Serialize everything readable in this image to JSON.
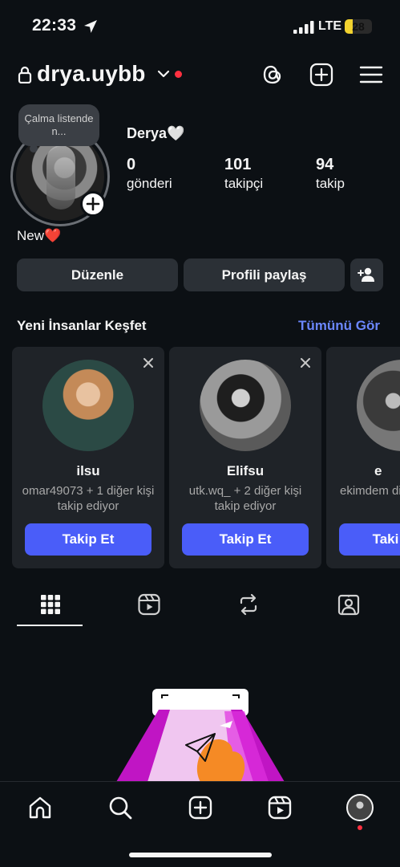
{
  "status_bar": {
    "time": "22:33",
    "network": "LTE",
    "battery": "28",
    "battery_level": 0.28
  },
  "header": {
    "username": "drya.uybb",
    "icons": [
      "lock-icon",
      "chevron-down-icon",
      "threads-icon",
      "create-icon",
      "menu-icon"
    ]
  },
  "profile": {
    "note": "Çalma listende n...",
    "display_name": "Derya🤍",
    "bio": "New❤️",
    "stats": [
      {
        "value": "0",
        "label": "gönderi"
      },
      {
        "value": "101",
        "label": "takipçi"
      },
      {
        "value": "94",
        "label": "takip"
      }
    ]
  },
  "actions": {
    "edit": "Düzenle",
    "share": "Profili paylaş"
  },
  "discover": {
    "title": "Yeni İnsanlar Keşfet",
    "see_all": "Tümünü Gör",
    "cards": [
      {
        "name": "ilsu",
        "subtitle": "omar49073 + 1 diğer kişi takip ediyor",
        "follow": "Takip Et"
      },
      {
        "name": "Elifsu",
        "subtitle": "utk.wq_ + 2 diğer kişi takip ediyor",
        "follow": "Takip Et"
      },
      {
        "name": "e",
        "subtitle": "ekimdem diğer kişi t",
        "follow": "Taki"
      }
    ]
  },
  "tabs": [
    "grid-icon",
    "reels-icon",
    "reposts-icon",
    "tagged-icon"
  ],
  "bottom_nav": [
    "home-icon",
    "search-icon",
    "create-icon",
    "reels-icon",
    "profile-avatar"
  ],
  "colors": {
    "background": "#0c1014",
    "button": "#2b3036",
    "accent": "#4a5df9",
    "link": "#6b87ff",
    "notification": "#ff3040"
  }
}
